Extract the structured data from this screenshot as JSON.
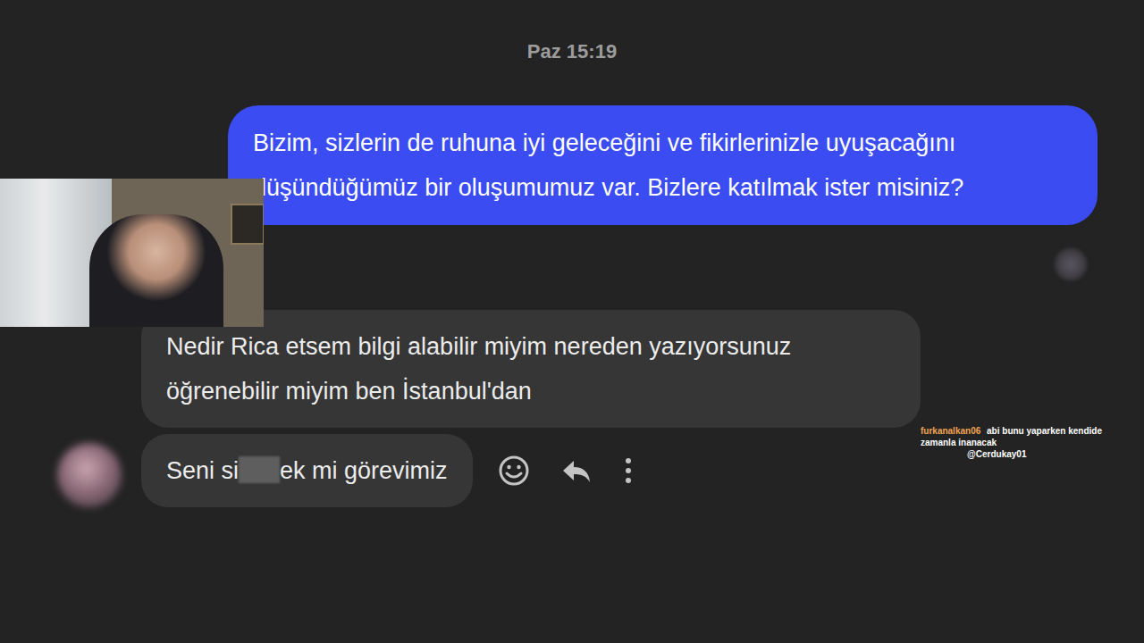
{
  "timestamp": "Paz 15:19",
  "messages": [
    {
      "direction": "outgoing",
      "parts": [
        {
          "kind": "text",
          "text": "Bizim, sizlerin de ruhuna iyi geleceğini ve fikirlerinizle uyuşacağını düşündüğümüz bir oluşumumuz var. Bizlere katılmak ister misiniz?"
        }
      ]
    },
    {
      "direction": "incoming",
      "parts": [
        {
          "kind": "text",
          "text": "Nedir Rica etsem bilgi alabilir miyim nereden yazıyorsunuz öğrenebilir miyim ben İstanbul'dan"
        }
      ]
    },
    {
      "direction": "incoming",
      "parts": [
        {
          "kind": "text",
          "text": "Seni si"
        },
        {
          "kind": "censored"
        },
        {
          "kind": "text",
          "text": "ek mi görevimiz"
        }
      ]
    }
  ],
  "stream_chat": {
    "username": "furkanalkan06",
    "message": "abi bunu yaparken kendide zamanla inanacak",
    "mention": "@Cerdukay01"
  }
}
